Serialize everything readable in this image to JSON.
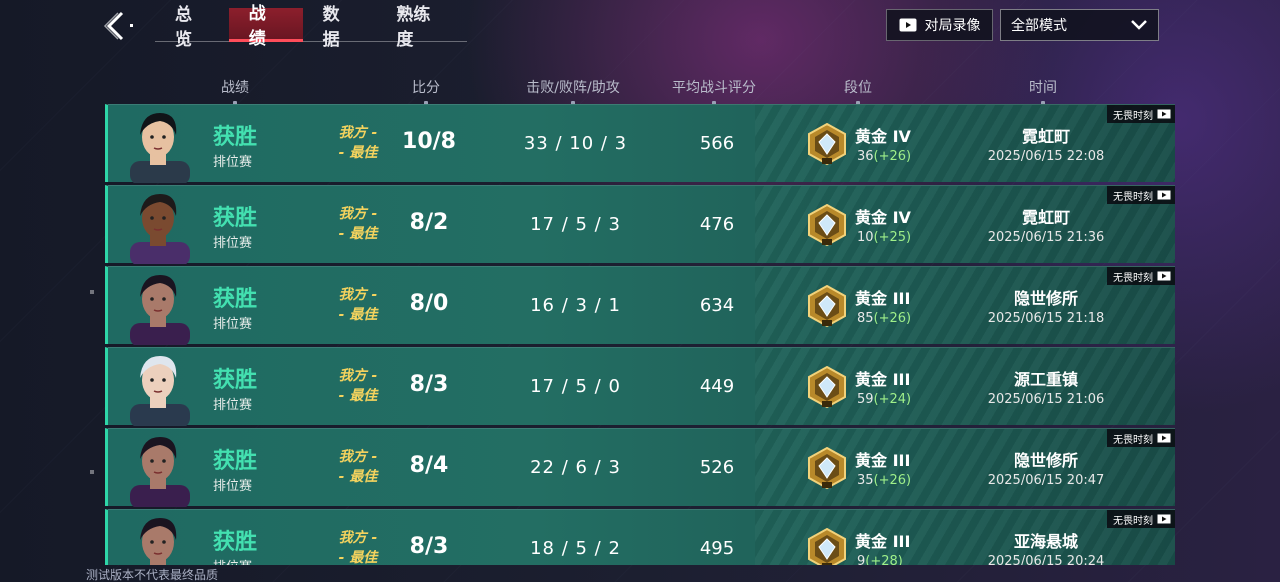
{
  "nav": {
    "tabs": [
      {
        "label": "总览",
        "active": false
      },
      {
        "label": "战绩",
        "active": true
      },
      {
        "label": "数据",
        "active": false
      },
      {
        "label": "熟练度",
        "active": false
      }
    ],
    "replay_label": "对局录像",
    "mode_select": {
      "value": "全部模式"
    }
  },
  "columns": {
    "record": "战绩",
    "score": "比分",
    "kda": "击败/败阵/助攻",
    "acs": "平均战斗评分",
    "rank": "段位",
    "time": "时间"
  },
  "matches": [
    {
      "result": "获胜",
      "queue": "排位赛",
      "mvp_line1": "我方 -",
      "mvp_line2": "- 最佳",
      "score": "10/8",
      "kda": "33 / 10 / 3",
      "acs": "566",
      "rank": "黄金 IV",
      "rr": "36",
      "rr_delta": "(+26)",
      "map": "霓虹町",
      "time": "2025/06/15 22:08",
      "moment": "无畏时刻",
      "agent_color": "#2b3a4a",
      "skin": "#e7c1a1",
      "hair": "#111418"
    },
    {
      "result": "获胜",
      "queue": "排位赛",
      "mvp_line1": "我方 -",
      "mvp_line2": "- 最佳",
      "score": "8/2",
      "kda": "17 / 5 / 3",
      "acs": "476",
      "rank": "黄金 IV",
      "rr": "10",
      "rr_delta": "(+25)",
      "map": "霓虹町",
      "time": "2025/06/15 21:36",
      "moment": "无畏时刻",
      "agent_color": "#4a2e6a",
      "skin": "#7a4a30",
      "hair": "#1d1a1a"
    },
    {
      "result": "获胜",
      "queue": "排位赛",
      "mvp_line1": "我方 -",
      "mvp_line2": "- 最佳",
      "score": "8/0",
      "kda": "16 / 3 / 1",
      "acs": "634",
      "rank": "黄金 III",
      "rr": "85",
      "rr_delta": "(+26)",
      "map": "隐世修所",
      "time": "2025/06/15 21:18",
      "moment": "无畏时刻",
      "agent_color": "#3a1f4e",
      "skin": "#a97a6a",
      "hair": "#1a1420"
    },
    {
      "result": "获胜",
      "queue": "排位赛",
      "mvp_line1": "我方 -",
      "mvp_line2": "- 最佳",
      "score": "8/3",
      "kda": "17 / 5 / 0",
      "acs": "449",
      "rank": "黄金 III",
      "rr": "59",
      "rr_delta": "(+24)",
      "map": "源工重镇",
      "time": "2025/06/15 21:06",
      "moment": "",
      "agent_color": "#2a3a4e",
      "skin": "#ecd0bd",
      "hair": "#dfe6ee"
    },
    {
      "result": "获胜",
      "queue": "排位赛",
      "mvp_line1": "我方 -",
      "mvp_line2": "- 最佳",
      "score": "8/4",
      "kda": "22 / 6 / 3",
      "acs": "526",
      "rank": "黄金 III",
      "rr": "35",
      "rr_delta": "(+26)",
      "map": "隐世修所",
      "time": "2025/06/15 20:47",
      "moment": "无畏时刻",
      "agent_color": "#3a1f4e",
      "skin": "#a97a6a",
      "hair": "#1a1420"
    },
    {
      "result": "获胜",
      "queue": "排位赛",
      "mvp_line1": "我方 -",
      "mvp_line2": "- 最佳",
      "score": "8/3",
      "kda": "18 / 5 / 2",
      "acs": "495",
      "rank": "黄金 III",
      "rr": "9",
      "rr_delta": "(+28)",
      "map": "亚海悬城",
      "time": "2025/06/15 20:24",
      "moment": "无畏时刻",
      "agent_color": "#3a1f4e",
      "skin": "#a97a6a",
      "hair": "#1a1420"
    }
  ],
  "watermark": "测试版本不代表最终品质",
  "colors": {
    "win": "#43e0b0",
    "mvp": "#f4d35e",
    "rr_delta": "#9ff08a",
    "tab_active": "#8c1f2c"
  }
}
